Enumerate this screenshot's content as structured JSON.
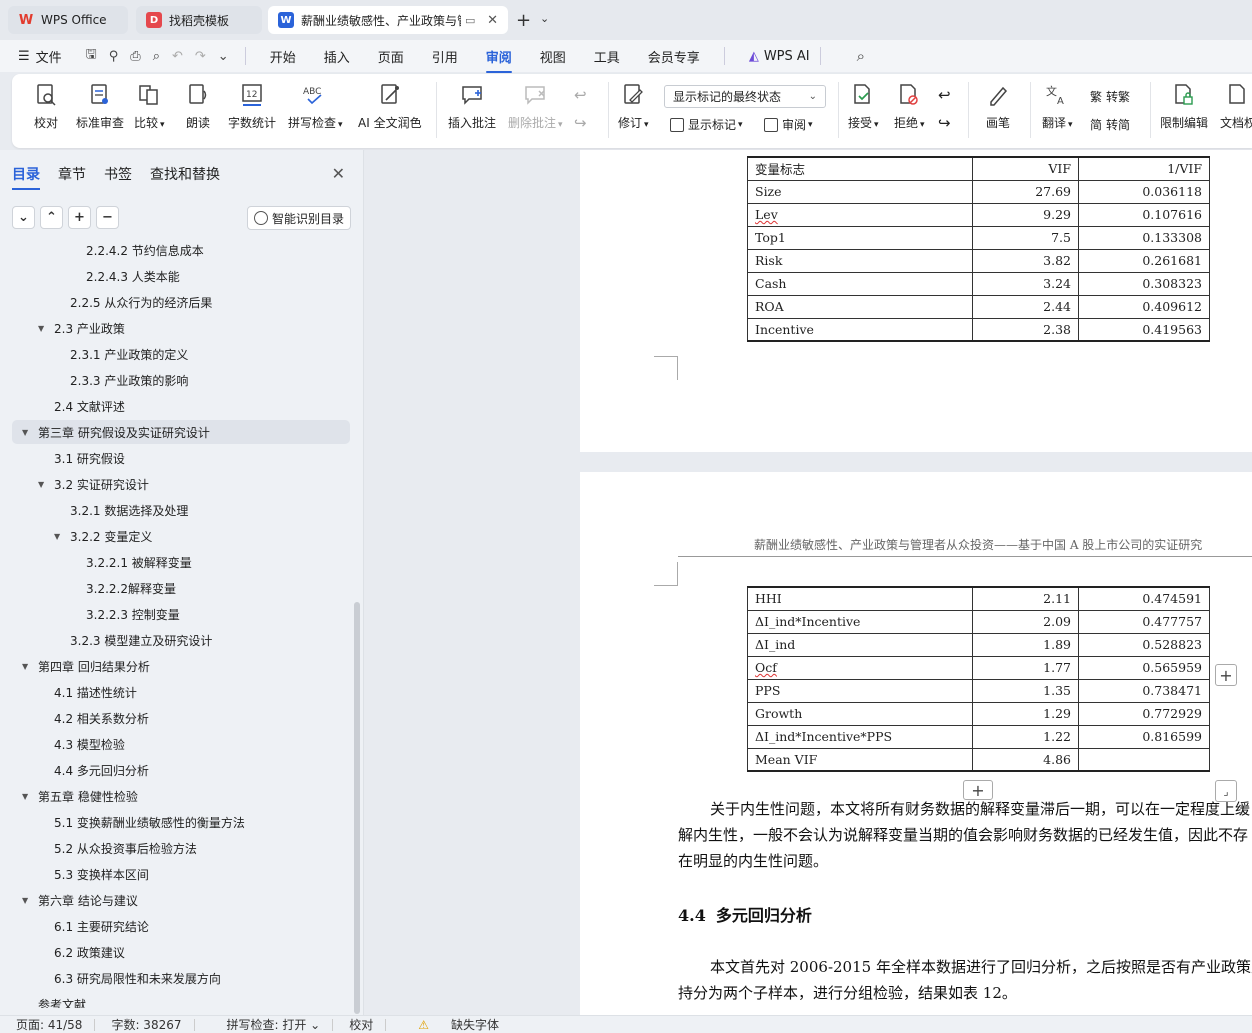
{
  "tabs": [
    {
      "label": "WPS Office"
    },
    {
      "label": "找稻壳模板"
    },
    {
      "label": "薪酬业绩敏感性、产业政策与管理者从众投资"
    }
  ],
  "menu": {
    "file": "文件",
    "tabs": [
      "开始",
      "插入",
      "页面",
      "引用",
      "审阅",
      "视图",
      "工具",
      "会员专享"
    ],
    "active": "审阅",
    "ai": "WPS AI"
  },
  "ribbon": {
    "proofread": "校对",
    "standard_review": "标准审查",
    "compare": "比较",
    "read_aloud": "朗读",
    "word_count": "字数统计",
    "spell_check": "拼写检查",
    "ai_polish": "AI 全文润色",
    "insert_comment": "插入批注",
    "delete_comment": "删除批注",
    "track_changes": "修订",
    "show_markup_select": "显示标记的最终状态",
    "show_markup": "显示标记",
    "review": "审阅",
    "accept": "接受",
    "reject": "拒绝",
    "pen": "画笔",
    "translate": "翻译",
    "to_traditional": "转繁",
    "to_simplified": "转简",
    "restrict_edit": "限制编辑",
    "doc_perm": "文档权"
  },
  "panel": {
    "tabs": [
      "目录",
      "章节",
      "书签",
      "查找和替换"
    ],
    "smart_toc": "智能识别目录",
    "toc": [
      {
        "text": "2.2.4.2  节约信息成本",
        "level": 4
      },
      {
        "text": "2.2.4.3  人类本能",
        "level": 4
      },
      {
        "text": "2.2.5  从众行为的经济后果",
        "level": 3
      },
      {
        "text": "2.3  产业政策",
        "level": 2,
        "expanded": true
      },
      {
        "text": "2.3.1  产业政策的定义",
        "level": 3
      },
      {
        "text": "2.3.3  产业政策的影响",
        "level": 3
      },
      {
        "text": "2.4  文献评述",
        "level": 2
      },
      {
        "text": "第三章  研究假设及实证研究设计",
        "level": 1,
        "expanded": true,
        "selected": true
      },
      {
        "text": "3.1  研究假设",
        "level": 2
      },
      {
        "text": "3.2  实证研究设计",
        "level": 2,
        "expanded": true
      },
      {
        "text": "3.2.1  数据选择及处理",
        "level": 3
      },
      {
        "text": "3.2.2  变量定义",
        "level": 3,
        "expanded": true
      },
      {
        "text": "3.2.2.1  被解释变量",
        "level": 4
      },
      {
        "text": "3.2.2.2解释变量",
        "level": 4
      },
      {
        "text": "3.2.2.3  控制变量",
        "level": 4
      },
      {
        "text": "3.2.3  模型建立及研究设计",
        "level": 3
      },
      {
        "text": "第四章  回归结果分析",
        "level": 1,
        "expanded": true
      },
      {
        "text": "4.1  描述性统计",
        "level": 2
      },
      {
        "text": "4.2  相关系数分析",
        "level": 2
      },
      {
        "text": "4.3  模型检验",
        "level": 2
      },
      {
        "text": "4.4  多元回归分析",
        "level": 2
      },
      {
        "text": "第五章  稳健性检验",
        "level": 1,
        "expanded": true
      },
      {
        "text": "5.1  变换薪酬业绩敏感性的衡量方法",
        "level": 2
      },
      {
        "text": "5.2  从众投资事后检验方法",
        "level": 2
      },
      {
        "text": "5.3  变换样本区间",
        "level": 2
      },
      {
        "text": "第六章  结论与建议",
        "level": 1,
        "expanded": true
      },
      {
        "text": "6.1  主要研究结论",
        "level": 2
      },
      {
        "text": "6.2  政策建议",
        "level": 2
      },
      {
        "text": "6.3  研究局限性和未来发展方向",
        "level": 2
      },
      {
        "text": "参考文献",
        "level": 1
      }
    ]
  },
  "doc": {
    "table1": {
      "header": [
        "变量标志",
        "VIF",
        "1/VIF"
      ],
      "rows": [
        [
          "Size",
          "27.69",
          "0.036118"
        ],
        [
          "Lev",
          "9.29",
          "0.107616"
        ],
        [
          "Top1",
          "7.5",
          "0.133308"
        ],
        [
          "Risk",
          "3.82",
          "0.261681"
        ],
        [
          "Cash",
          "3.24",
          "0.308323"
        ],
        [
          "ROA",
          "2.44",
          "0.409612"
        ],
        [
          "Incentive",
          "2.38",
          "0.419563"
        ]
      ]
    },
    "page_header": "薪酬业绩敏感性、产业政策与管理者从众投资——基于中国 A 股上市公司的实证研究",
    "table2": {
      "rows": [
        [
          "HHI",
          "2.11",
          "0.474591"
        ],
        [
          "ΔI_ind*Incentive",
          "2.09",
          "0.477757"
        ],
        [
          "ΔI_ind",
          "1.89",
          "0.528823"
        ],
        [
          "Ocf",
          "1.77",
          "0.565959"
        ],
        [
          "PPS",
          "1.35",
          "0.738471"
        ],
        [
          "Growth",
          "1.29",
          "0.772929"
        ],
        [
          "ΔI_ind*Incentive*PPS",
          "1.22",
          "0.816599"
        ],
        [
          "Mean VIF",
          "4.86",
          ""
        ]
      ]
    },
    "para1": [
      "关于内生性问题，本文将所有财务数据的解释变量滞后一期，可以在一定程度上缓",
      "解内生性，一般不会认为说解释变量当期的值会影响财务数据的已经发生值，因此不存",
      "在明显的内生性问题。"
    ],
    "heading_num": "4.4",
    "heading_text": "多元回归分析",
    "para2": [
      "本文首先对 2006-2015 年全样本数据进行了回归分析，之后按照是否有产业政策支",
      "持分为两个子样本，进行分组检验，结果如表 12。"
    ]
  },
  "status": {
    "page": "页面: 41/58",
    "words": "字数: 38267",
    "spell": "拼写检查: 打开",
    "proof": "校对",
    "missing_font": "缺失字体"
  }
}
